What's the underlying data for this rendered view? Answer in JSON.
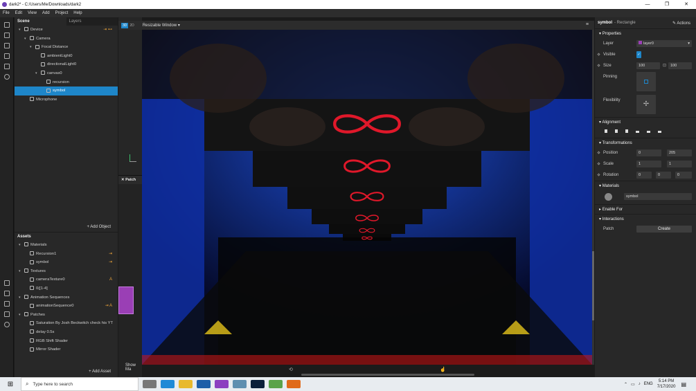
{
  "window": {
    "title": "dark2* - C:/Users/Me/Downloads/dark2",
    "min": "—",
    "max": "❐",
    "close": "✕"
  },
  "menu": [
    "File",
    "Edit",
    "View",
    "Add",
    "Project",
    "Help"
  ],
  "scene_panel": {
    "tabs": [
      "Scene",
      "Layers"
    ],
    "tree": [
      {
        "label": "Device",
        "depth": 0,
        "arrow": "▾",
        "mark": "⇥ ⊷"
      },
      {
        "label": "Camera",
        "depth": 1,
        "arrow": "▾"
      },
      {
        "label": "Focal Distance",
        "depth": 2,
        "arrow": "▾"
      },
      {
        "label": "ambientLight0",
        "depth": 3,
        "arrow": ""
      },
      {
        "label": "directionalLight0",
        "depth": 3,
        "arrow": ""
      },
      {
        "label": "canvas0",
        "depth": 3,
        "arrow": "▾"
      },
      {
        "label": "recursion",
        "depth": 4,
        "arrow": ""
      },
      {
        "label": "symbol",
        "depth": 4,
        "arrow": "",
        "selected": true
      },
      {
        "label": "Microphone",
        "depth": 1,
        "arrow": ""
      }
    ],
    "add_object": "+ Add Object"
  },
  "assets_panel": {
    "title": "Assets",
    "tree": [
      {
        "label": "Materials",
        "depth": 0,
        "arrow": "▾"
      },
      {
        "label": "Recursion1",
        "depth": 1,
        "arrow": "",
        "mark": "⇥"
      },
      {
        "label": "symbol",
        "depth": 1,
        "arrow": "",
        "mark": "⇥"
      },
      {
        "label": "Textures",
        "depth": 0,
        "arrow": "▾"
      },
      {
        "label": "cameraTexture0",
        "depth": 1,
        "arrow": "",
        "mark": "A"
      },
      {
        "label": "0([1-4]",
        "depth": 1,
        "arrow": ""
      },
      {
        "label": "Animation Sequences",
        "depth": 0,
        "arrow": "▾"
      },
      {
        "label": "animationSequence0",
        "depth": 1,
        "arrow": "",
        "mark": "⇥ A"
      },
      {
        "label": "Patches",
        "depth": 0,
        "arrow": "▾"
      },
      {
        "label": "Saturation By Josh Beckwitch check his YT",
        "depth": 1,
        "arrow": ""
      },
      {
        "label": "delay 0.5s",
        "depth": 1,
        "arrow": ""
      },
      {
        "label": "RGB Shift Shader",
        "depth": 1,
        "arrow": ""
      },
      {
        "label": "Mirror Shader",
        "depth": 1,
        "arrow": ""
      }
    ],
    "add_asset": "+ Add Asset"
  },
  "patch_panel": {
    "title": "Patch",
    "show_label": "Show Ma"
  },
  "viewport": {
    "btn3d": "3D",
    "btn2d": "2D",
    "mode": "Resizable Window ▾",
    "menu_icon": "≡",
    "symbol_color": "#e0182a"
  },
  "inspector": {
    "name": "symbol",
    "type": "- Rectangle",
    "actions": "Actions",
    "sections": {
      "properties": "Properties",
      "alignment": "Alignment",
      "transformations": "Transformations",
      "materials": "Materials",
      "enable_for": "Enable For",
      "interactions": "Interactions"
    },
    "layer_label": "Layer",
    "layer_value": "layer0",
    "visible_label": "Visible",
    "size_label": "Size",
    "size_w": "100",
    "size_h": "100",
    "pinning_label": "Pinning",
    "flexibility_label": "Flexibility",
    "position_label": "Position",
    "pos_x": "0",
    "pos_y": "205",
    "scale_label": "Scale",
    "scale_x": "1",
    "scale_y": "1",
    "rotation_label": "Rotation",
    "rot_x": "0",
    "rot_y": "0",
    "rot_z": "0",
    "material_value": "symbol",
    "patch_label": "Patch",
    "create_label": "Create"
  },
  "taskbar": {
    "search_placeholder": "Type here to search",
    "lang": "ENG",
    "time": "5:14 PM",
    "date": "7/17/2020"
  }
}
